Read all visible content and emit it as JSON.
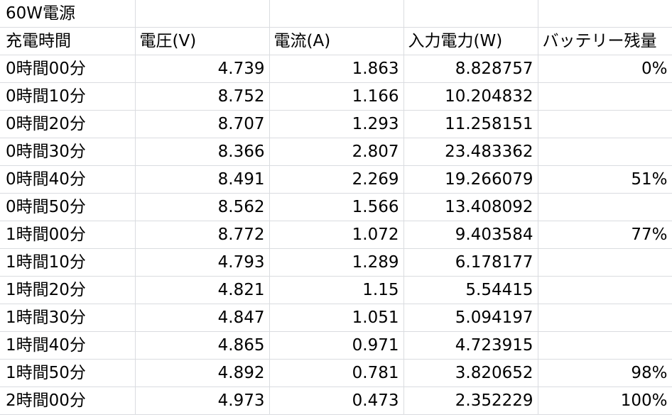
{
  "title_cell": "60W電源",
  "headers": [
    "充電時間",
    "電圧(V)",
    "電流(A)",
    "入力電力(W)",
    "バッテリー残量"
  ],
  "rows": [
    [
      "0時間00分",
      "4.739",
      "1.863",
      "8.828757",
      "0%"
    ],
    [
      "0時間10分",
      "8.752",
      "1.166",
      "10.204832",
      ""
    ],
    [
      "0時間20分",
      "8.707",
      "1.293",
      "11.258151",
      ""
    ],
    [
      "0時間30分",
      "8.366",
      "2.807",
      "23.483362",
      ""
    ],
    [
      "0時間40分",
      "8.491",
      "2.269",
      "19.266079",
      "51%"
    ],
    [
      "0時間50分",
      "8.562",
      "1.566",
      "13.408092",
      ""
    ],
    [
      "1時間00分",
      "8.772",
      "1.072",
      "9.403584",
      "77%"
    ],
    [
      "1時間10分",
      "4.793",
      "1.289",
      "6.178177",
      ""
    ],
    [
      "1時間20分",
      "4.821",
      "1.15",
      "5.54415",
      ""
    ],
    [
      "1時間30分",
      "4.847",
      "1.051",
      "5.094197",
      ""
    ],
    [
      "1時間40分",
      "4.865",
      "0.971",
      "4.723915",
      ""
    ],
    [
      "1時間50分",
      "4.892",
      "0.781",
      "3.820652",
      "98%"
    ],
    [
      "2時間00分",
      "4.973",
      "0.473",
      "2.352229",
      "100%"
    ]
  ]
}
